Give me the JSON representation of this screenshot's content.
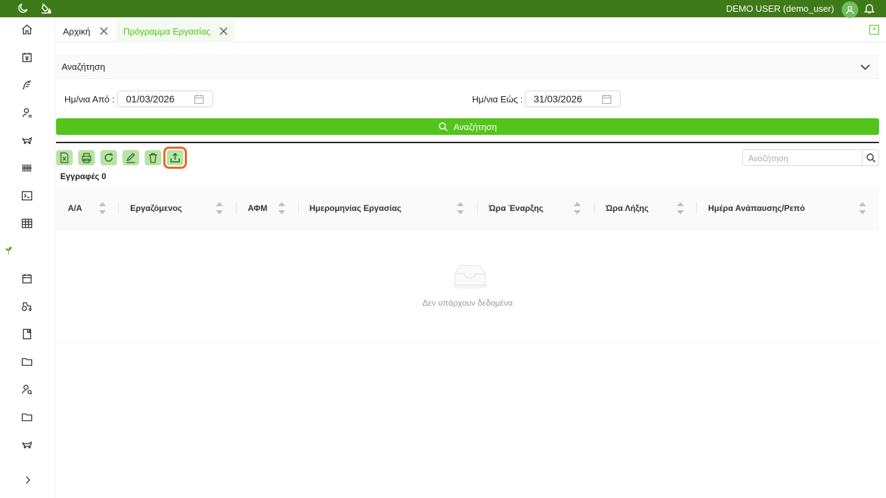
{
  "topbar": {
    "user": "DEMO USER (demo_user)"
  },
  "tabs": [
    {
      "label": "Αρχική"
    },
    {
      "label": "Πρόγραμμα Εργασίας"
    }
  ],
  "search_panel": {
    "title": "Αναζήτηση",
    "date_from_label": "Ημ/νια Από :",
    "date_from_value": "01/03/2026",
    "date_to_label": "Ημ/νια Εώς :",
    "date_to_value": "31/03/2026",
    "button_label": "Αναζήτηση"
  },
  "toolbar": {
    "icons": [
      "excel-export-icon",
      "print-icon",
      "refresh-icon",
      "edit-icon",
      "delete-icon",
      "upload-icon"
    ],
    "search_placeholder": "Αναζήτηση"
  },
  "table": {
    "records_label": "Εγγραφές 0",
    "columns": [
      "Α/Α",
      "Εργαζόμενος",
      "ΑΦΜ",
      "Ημερομηνίας Εργασίας",
      "Ώρα Έναρξης",
      "Ώρα Λήξης",
      "Ημέρα Ανάπαυσης/Ρεπό"
    ],
    "empty_text": "Δεν υπάρχουν δεδομένα"
  },
  "colors": {
    "topbar": "#3f7a1a",
    "accent": "#52c41a",
    "toolbar_button": "#b7e3a6",
    "highlight": "#e8661f"
  }
}
